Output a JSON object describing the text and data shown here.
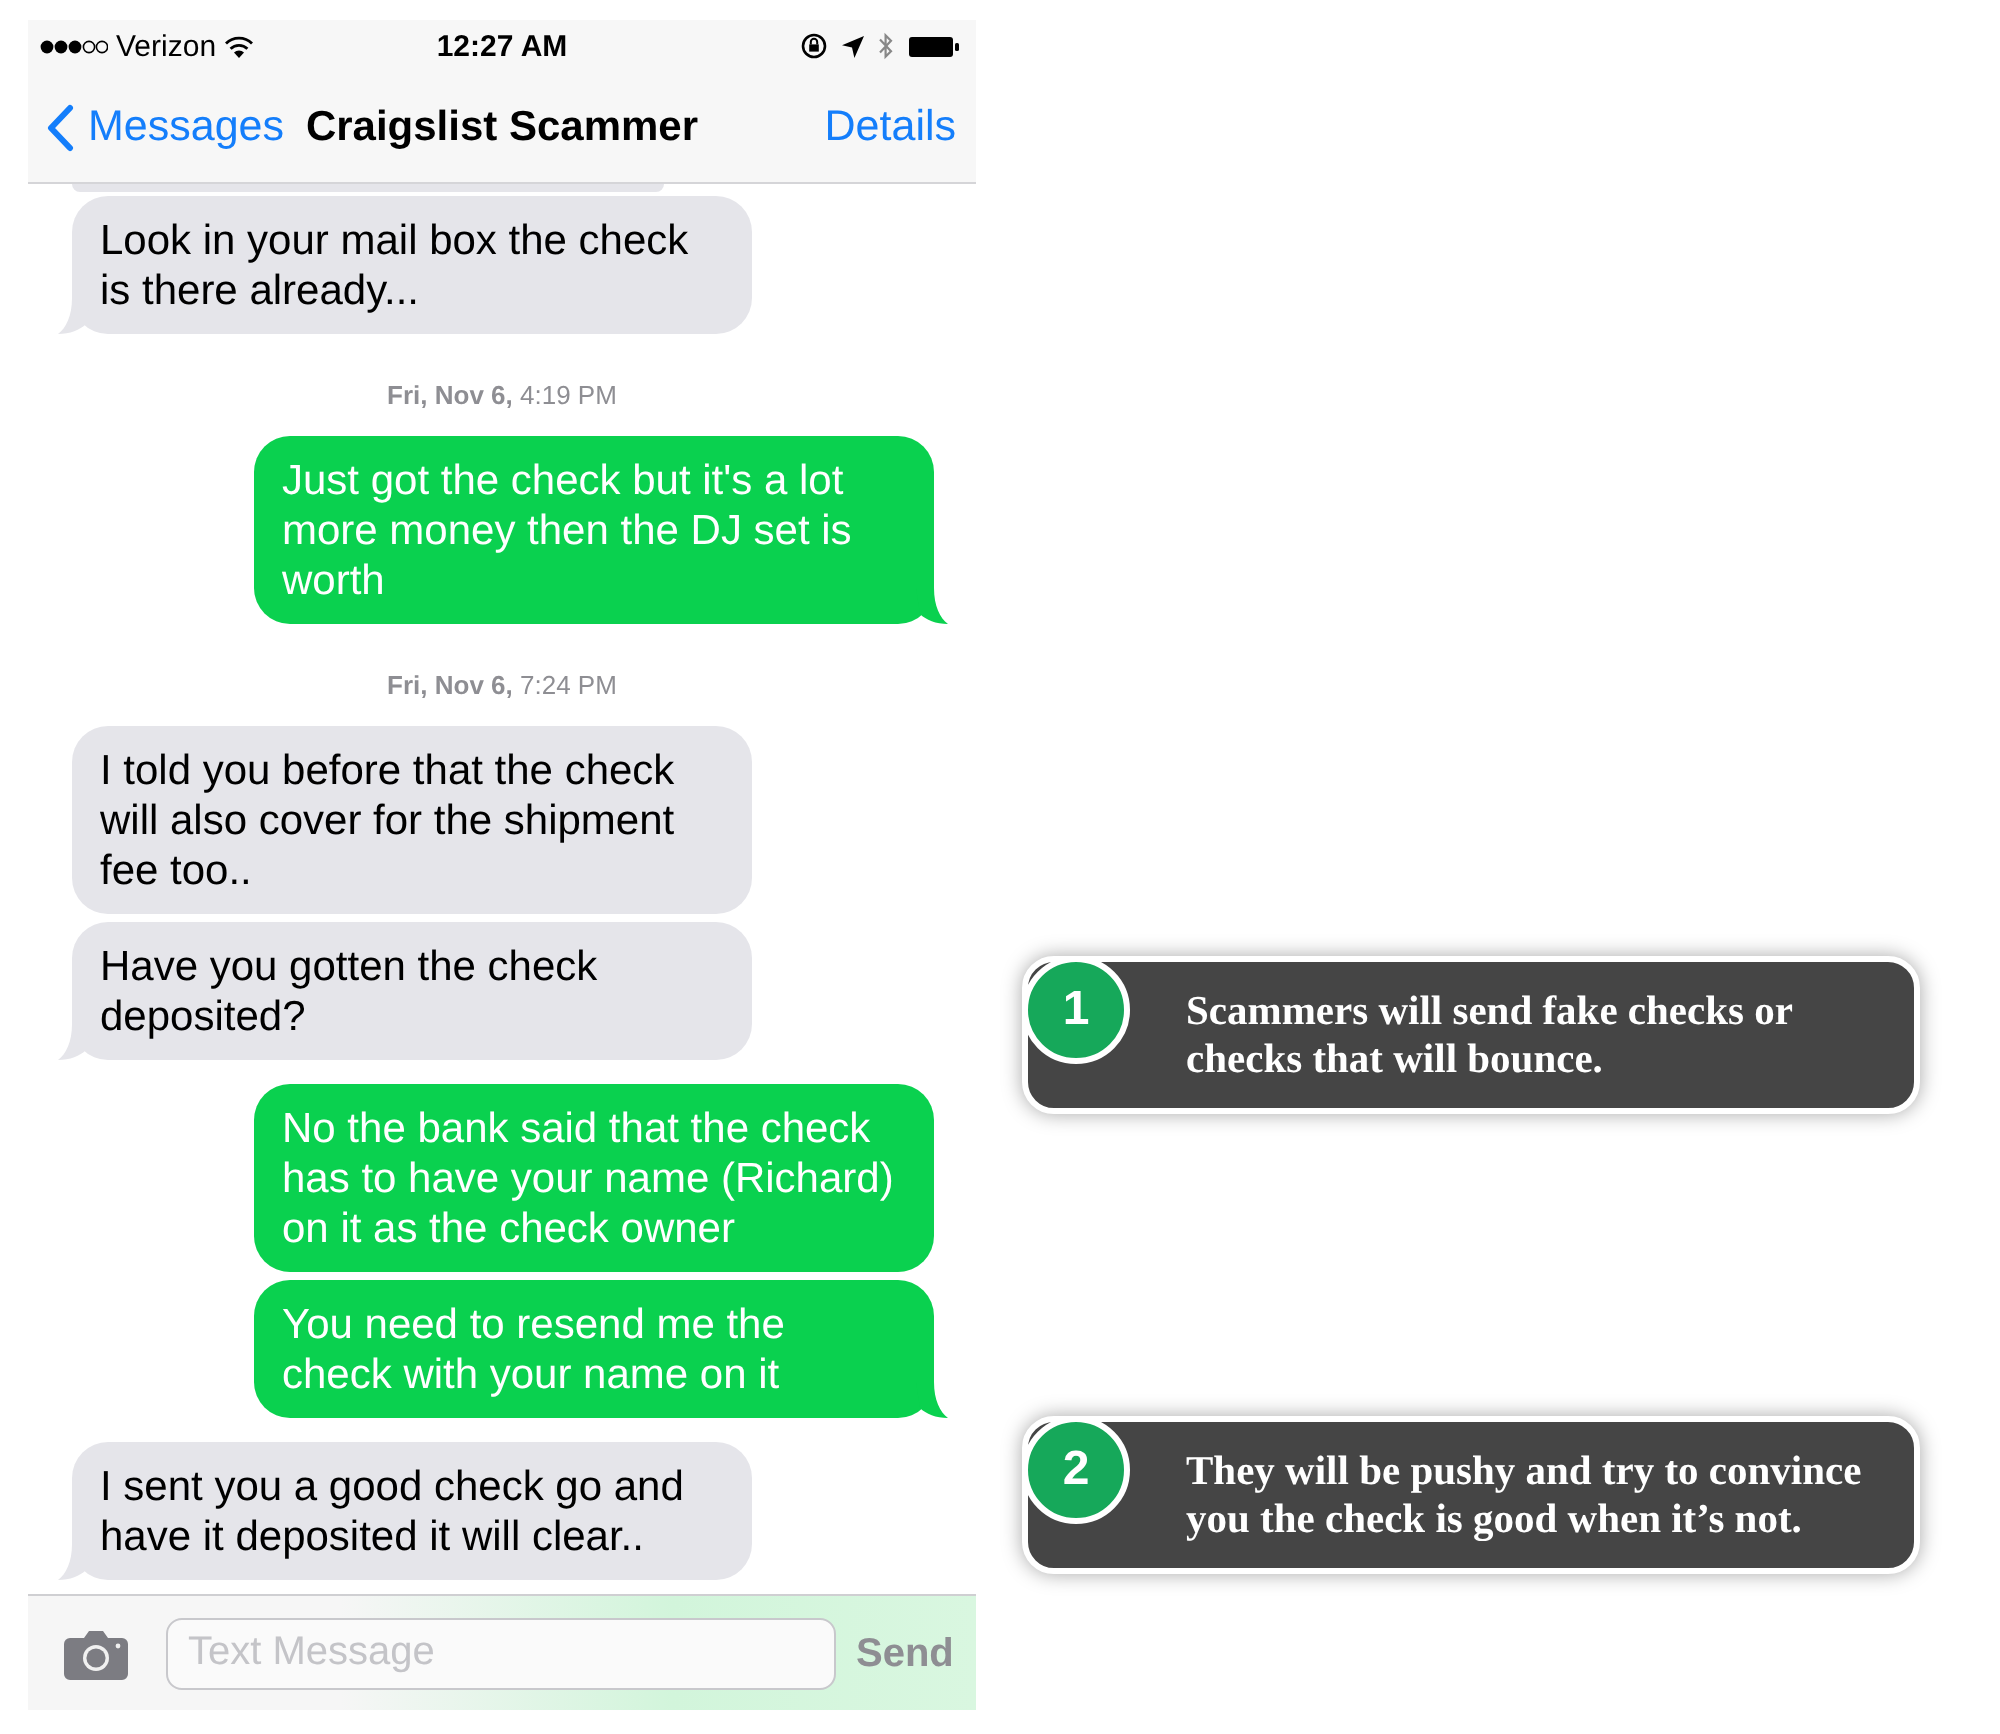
{
  "status_bar": {
    "carrier": "Verizon",
    "time": "12:27 AM"
  },
  "nav_bar": {
    "back": "Messages",
    "title": "Craigslist Scammer",
    "action": "Details"
  },
  "messages": [
    {
      "kind": "received",
      "tail": true,
      "text": "Look in your mail box the check is there already..."
    },
    {
      "kind": "timestamp",
      "text": "**Fri, Nov 6,** 4:19 PM"
    },
    {
      "kind": "sent",
      "tail": true,
      "text": "Just got the check but it's a lot more money then the DJ set is worth"
    },
    {
      "kind": "timestamp",
      "text": "**Fri, Nov 6,** 7:24 PM"
    },
    {
      "kind": "received",
      "tail": false,
      "text": "I told you before that the check will also cover for the shipment fee too.."
    },
    {
      "kind": "received",
      "tail": true,
      "text": "Have you gotten the check deposited?"
    },
    {
      "kind": "sent",
      "tail": false,
      "text": "No the bank said that the check has to have your name (Richard) on it as the check owner"
    },
    {
      "kind": "sent",
      "tail": true,
      "text": "You need to resend me the check with your name on it"
    },
    {
      "kind": "received",
      "tail": true,
      "text": "I sent you a good check go and have it deposited it will clear.."
    }
  ],
  "composer": {
    "placeholder": "Text Message",
    "send": "Send"
  },
  "callouts": [
    {
      "number": "1",
      "text": "Scammers will send fake checks or checks that will bounce."
    },
    {
      "number": "2",
      "text": "They will be pushy and try to convince you the check is good when it’s not."
    }
  ]
}
